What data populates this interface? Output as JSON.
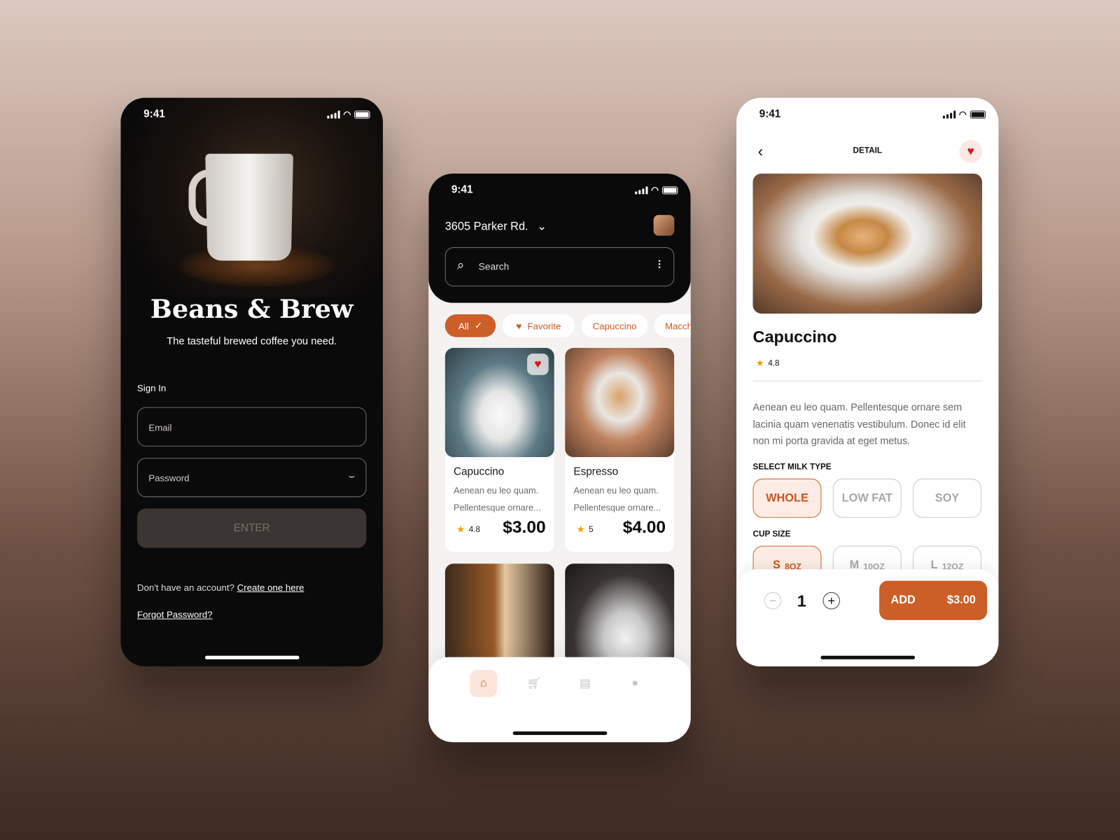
{
  "status_time": "9:41",
  "signin": {
    "brand": "Beans & Brew",
    "tagline": "The tasteful brewed coffee you need.",
    "section_label": "Sign In",
    "email_placeholder": "Email",
    "password_placeholder": "Password",
    "enter_label": "ENTER",
    "no_account_text": "Don't have an account?",
    "create_link": "Create one here",
    "forgot_link": "Forgot Password?"
  },
  "home": {
    "location": "3605 Parker Rd.",
    "search_placeholder": "Search",
    "chips": [
      {
        "label": "All",
        "selected": true
      },
      {
        "label": "Favorite",
        "icon": "heart-icon"
      },
      {
        "label": "Capuccino"
      },
      {
        "label": "Macchiato"
      }
    ],
    "products": [
      {
        "name": "Capuccino",
        "desc1": "Aenean eu leo quam.",
        "desc2": "Pellentesque ornare...",
        "rating": "4.8",
        "price": "$3.00",
        "favorite": true
      },
      {
        "name": "Espresso",
        "desc1": "Aenean eu leo quam.",
        "desc2": "Pellentesque ornare...",
        "rating": "5",
        "price": "$4.00",
        "favorite": false
      }
    ],
    "tabs": [
      "home-icon",
      "cart-icon",
      "orders-icon",
      "profile-icon"
    ],
    "active_tab": "home"
  },
  "detail": {
    "header": "DETAIL",
    "name": "Capuccino",
    "rating": "4.8",
    "description": "Aenean eu leo quam. Pellentesque ornare sem lacinia quam venenatis vestibulum. Donec id elit non mi porta gravida at eget metus.",
    "milk_label": "SELECT MILK TYPE",
    "milk_options": [
      "WHOLE",
      "LOW FAT",
      "SOY"
    ],
    "milk_selected": "WHOLE",
    "size_label": "CUP SIZE",
    "sizes": [
      {
        "letter": "S",
        "oz": "8OZ"
      },
      {
        "letter": "M",
        "oz": "10OZ"
      },
      {
        "letter": "L",
        "oz": "12OZ"
      }
    ],
    "size_selected": "S",
    "quantity": "1",
    "add_label": "ADD",
    "add_price": "$3.00"
  },
  "colors": {
    "accent": "#cc5e27",
    "star": "#f0a000",
    "heart": "#e0141e",
    "dark": "#0b0a0a"
  }
}
